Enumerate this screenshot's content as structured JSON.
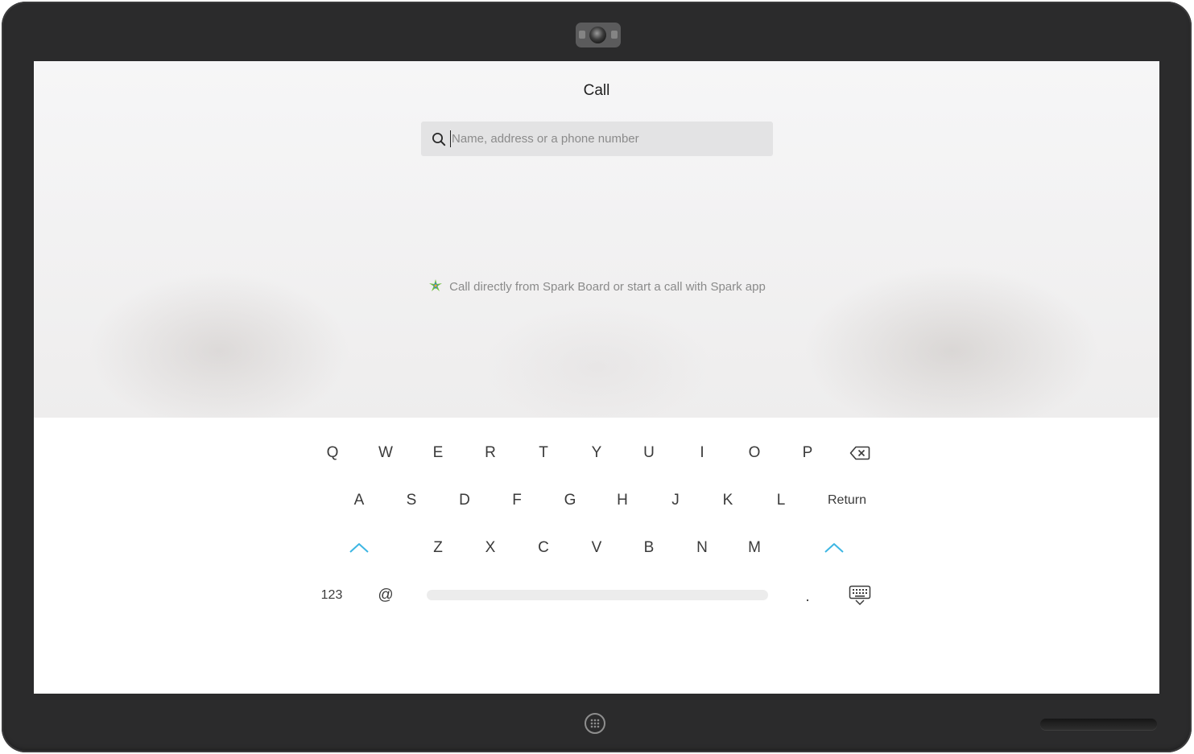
{
  "screen": {
    "title": "Call",
    "search": {
      "placeholder": "Name, address or a phone number",
      "value": ""
    },
    "hint": {
      "icon": "spark-icon",
      "text": "Call directly from Spark Board or start a call with Spark app"
    }
  },
  "keyboard": {
    "row1": [
      "Q",
      "W",
      "E",
      "R",
      "T",
      "Y",
      "U",
      "I",
      "O",
      "P"
    ],
    "row2": [
      "A",
      "S",
      "D",
      "F",
      "G",
      "H",
      "J",
      "K",
      "L"
    ],
    "return_label": "Return",
    "row3": [
      "Z",
      "X",
      "C",
      "V",
      "B",
      "N",
      "M"
    ],
    "numbers_label": "123",
    "at_label": "@",
    "period_label": ".",
    "icons": {
      "backspace": "backspace-icon",
      "shift": "shift-arrow-icon",
      "hide": "keyboard-hide-icon"
    }
  },
  "device": {
    "home_button_icon": "home-grid-icon"
  },
  "colors": {
    "accent": "#3cb6e3",
    "bezel": "#2b2b2c"
  }
}
